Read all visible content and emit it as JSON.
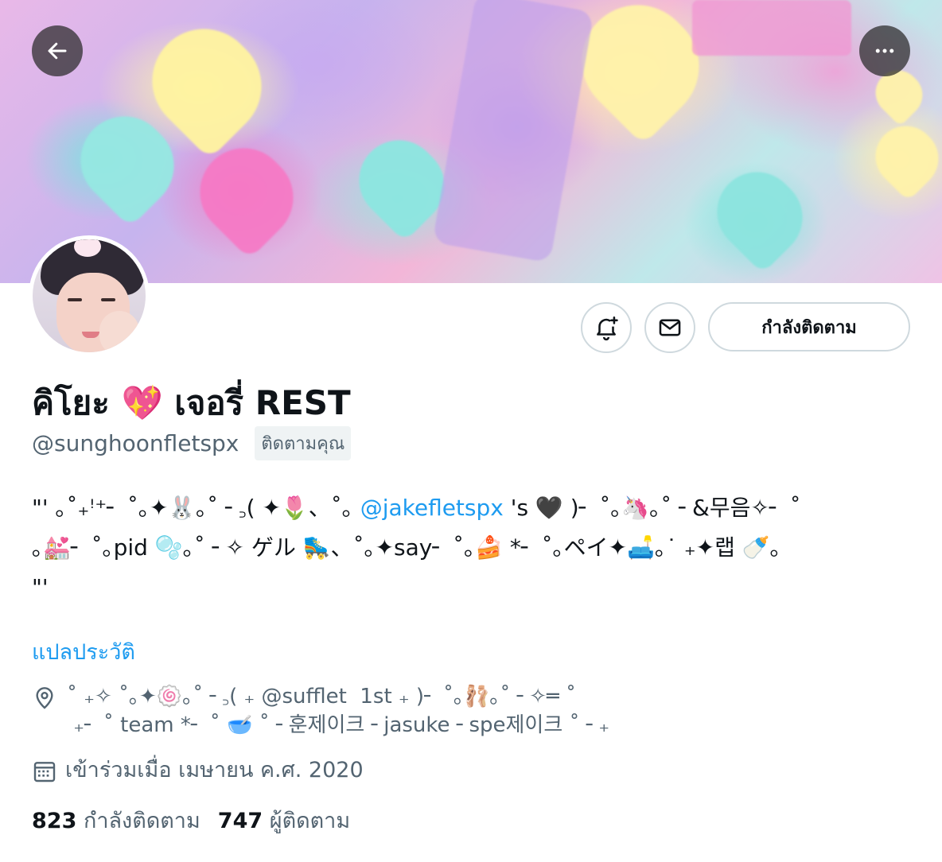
{
  "header": {
    "back_icon": "arrow-left-icon",
    "more_icon": "more-horizontal-icon"
  },
  "profile": {
    "display_name": "คิโยะ 💖 เจอรี่ REST",
    "handle": "@sunghoonfletspx",
    "follows_you": "ติดตามคุณ",
    "follow_button": "กำลังติดตาม",
    "bio_line1_pre": "\"' ｡˚₊ꜝ⁺╴ ˚｡✦🐰｡˚ ╴꜆( ✦🌷、˚｡",
    "bio_mention": "@jakefletspx",
    "bio_line1_post": " 's 🖤 )╴ ˚｡🦄｡˚ ╴&무음✧╴ ˚",
    "bio_line2": "｡💒╴ ˚｡pid 🫧｡˚ ╴✧ ゲル 🛼、˚｡✦say╴ ˚｡🍰 *╴ ˚｡ペイ✦🛋️｡˙ ₊✦랩 🍼｡",
    "bio_line3": "\"'",
    "translate_bio": "แปลประวัติ",
    "location": "˚ ₊✧ ˚｡✦🍥｡˚ ╴꜆( ₊ @sufflet  1st ₊ )╴ ˚｡🩰｡˚ ╴✧═ ˚\n ₊╴ ˚ team *╴ ˚ 🥣 ˚ ╴훈제이크 ╴jasuke ╴spe제이크 ˚ ╴₊",
    "joined": "เข้าร่วมเมื่อ เมษายน ค.ศ. 2020",
    "following_count": "823",
    "following_label": "กำลังติดตาม",
    "followers_count": "747",
    "followers_label": "ผู้ติดตาม"
  },
  "colors": {
    "accent": "#1d9bf0",
    "secondary_text": "#536471",
    "border": "#cfd9de"
  }
}
